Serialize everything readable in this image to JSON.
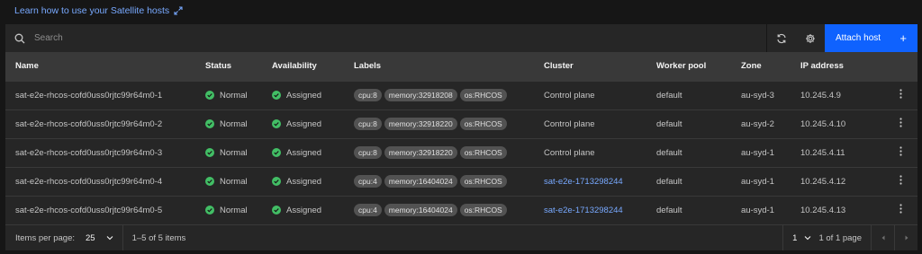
{
  "learn_link": "Learn how to use your Satellite hosts",
  "search": {
    "placeholder": "Search"
  },
  "toolbar": {
    "attach_label": "Attach host",
    "attach_icon": "plus-icon"
  },
  "table": {
    "headers": [
      "Name",
      "Status",
      "Availability",
      "Labels",
      "Cluster",
      "Worker pool",
      "Zone",
      "IP address"
    ],
    "rows": [
      {
        "name": "sat-e2e-rhcos-cofd0uss0rjtc99r64m0-1",
        "status": "Normal",
        "availability": "Assigned",
        "labels": [
          "cpu:8",
          "memory:32918208",
          "os:RHCOS"
        ],
        "cluster": "Control plane",
        "cluster_link": false,
        "pool": "default",
        "zone": "au-syd-3",
        "ip": "10.245.4.9"
      },
      {
        "name": "sat-e2e-rhcos-cofd0uss0rjtc99r64m0-2",
        "status": "Normal",
        "availability": "Assigned",
        "labels": [
          "cpu:8",
          "memory:32918220",
          "os:RHCOS"
        ],
        "cluster": "Control plane",
        "cluster_link": false,
        "pool": "default",
        "zone": "au-syd-2",
        "ip": "10.245.4.10"
      },
      {
        "name": "sat-e2e-rhcos-cofd0uss0rjtc99r64m0-3",
        "status": "Normal",
        "availability": "Assigned",
        "labels": [
          "cpu:8",
          "memory:32918220",
          "os:RHCOS"
        ],
        "cluster": "Control plane",
        "cluster_link": false,
        "pool": "default",
        "zone": "au-syd-1",
        "ip": "10.245.4.11"
      },
      {
        "name": "sat-e2e-rhcos-cofd0uss0rjtc99r64m0-4",
        "status": "Normal",
        "availability": "Assigned",
        "labels": [
          "cpu:4",
          "memory:16404024",
          "os:RHCOS"
        ],
        "cluster": "sat-e2e-1713298244",
        "cluster_link": true,
        "pool": "default",
        "zone": "au-syd-1",
        "ip": "10.245.4.12"
      },
      {
        "name": "sat-e2e-rhcos-cofd0uss0rjtc99r64m0-5",
        "status": "Normal",
        "availability": "Assigned",
        "labels": [
          "cpu:4",
          "memory:16404024",
          "os:RHCOS"
        ],
        "cluster": "sat-e2e-1713298244",
        "cluster_link": true,
        "pool": "default",
        "zone": "au-syd-1",
        "ip": "10.245.4.13"
      }
    ]
  },
  "pagination": {
    "items_per_page_label": "Items per page:",
    "items_per_page": "25",
    "range": "1–5 of 5 items",
    "page": "1",
    "page_of": "1 of 1 page"
  },
  "colors": {
    "accent": "#0f62fe",
    "link": "#78a9ff",
    "status_ok": "#42be65"
  }
}
